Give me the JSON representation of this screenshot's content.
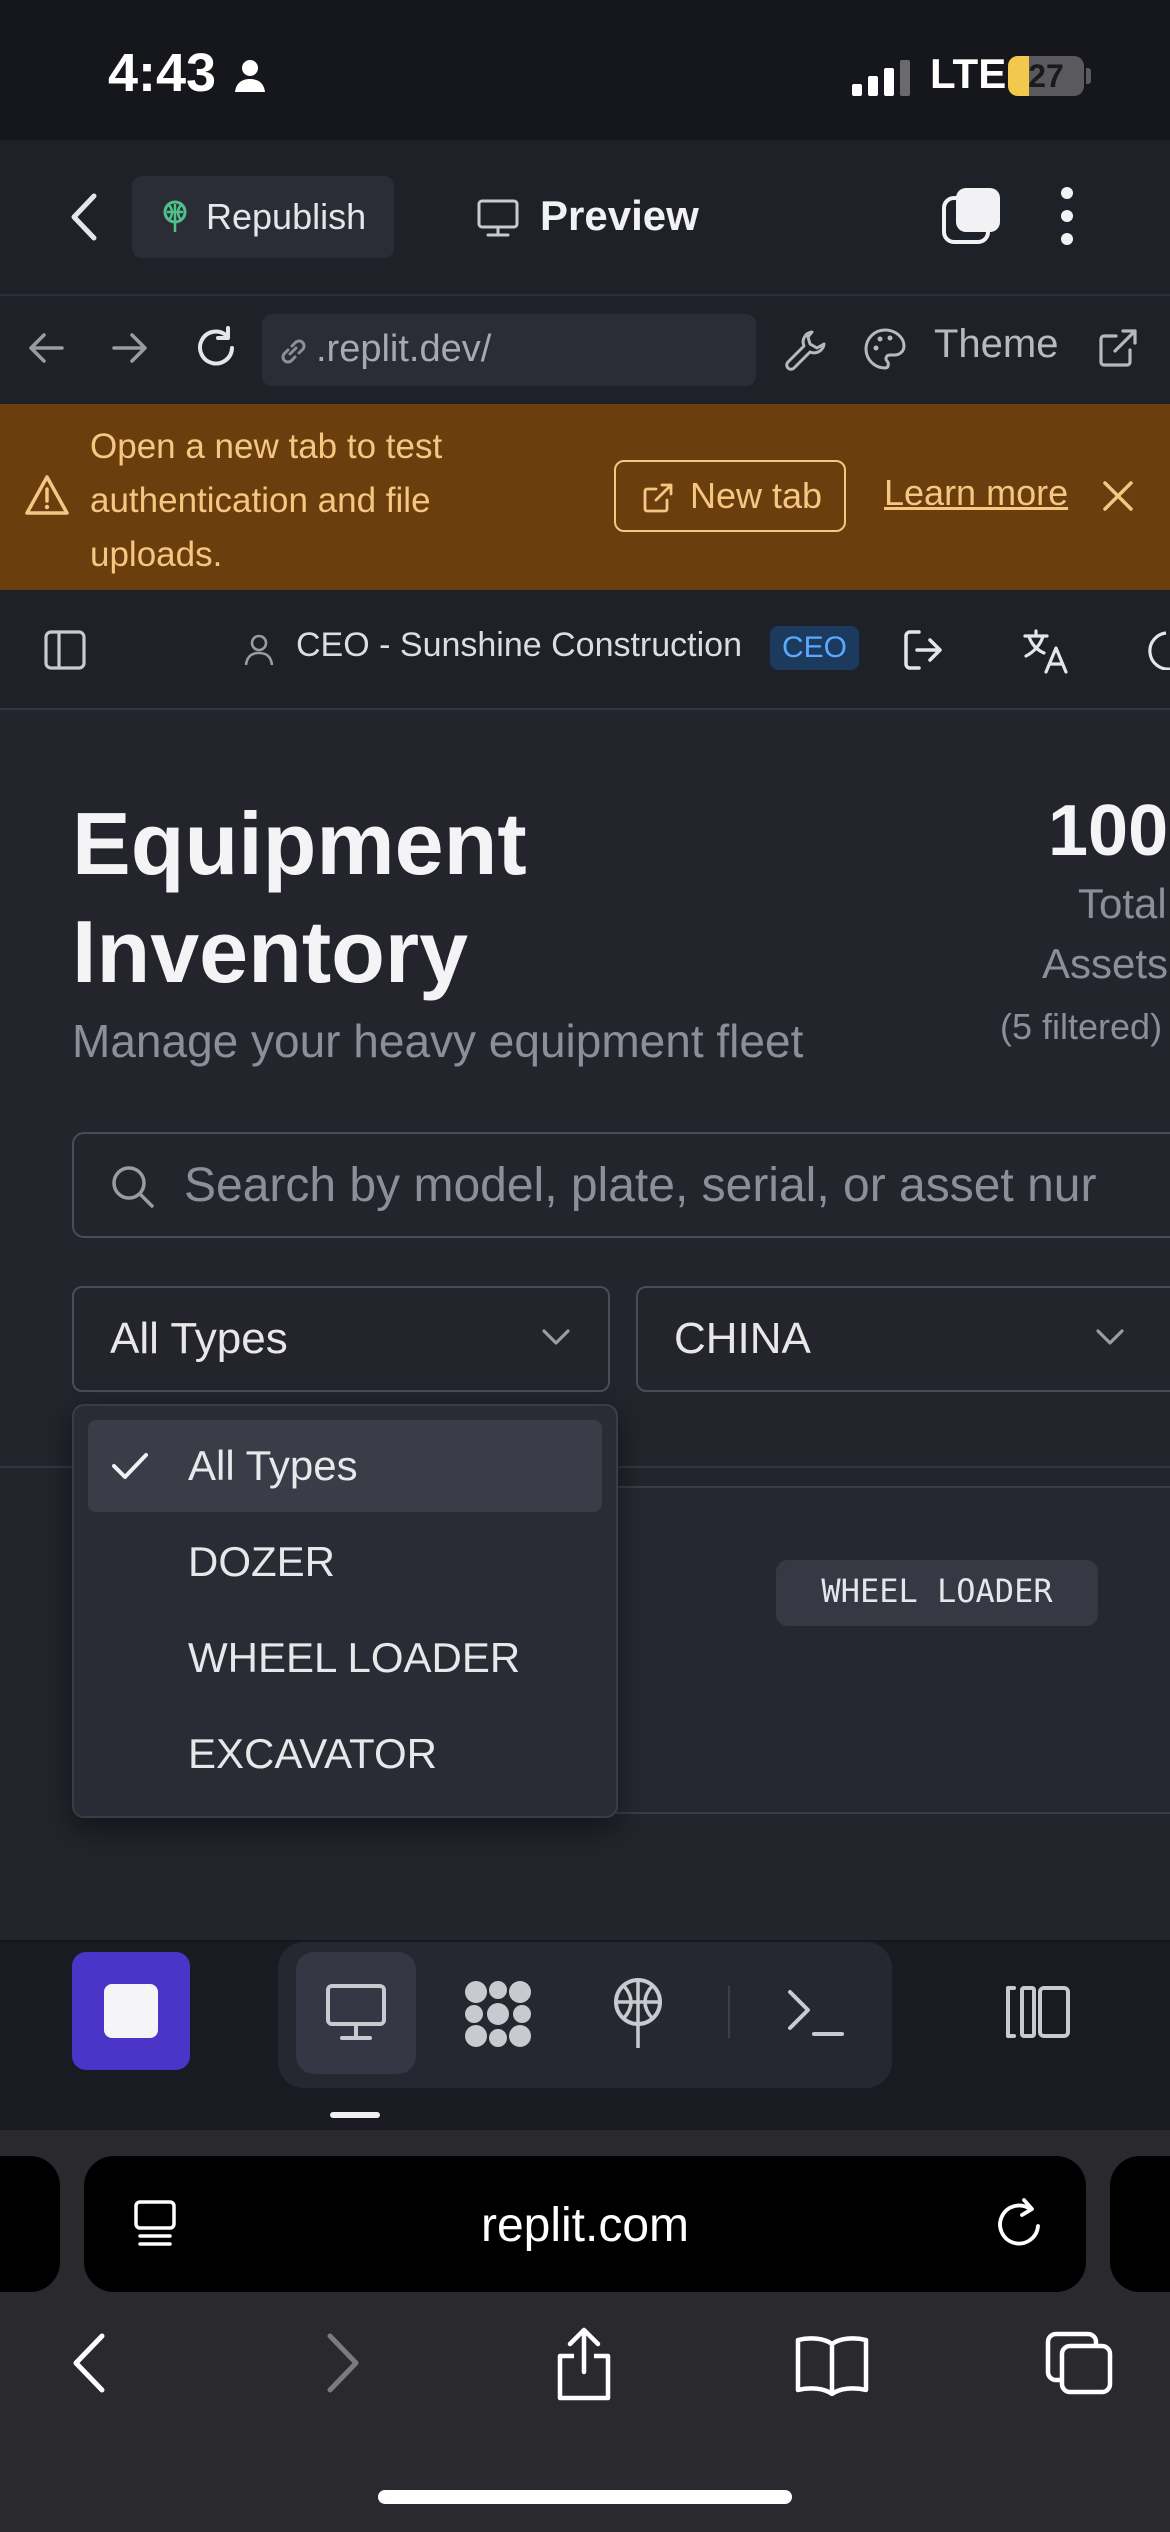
{
  "status_bar": {
    "time": "4:43",
    "network": "LTE",
    "battery": "27",
    "battery_level": 0.27
  },
  "toolbar": {
    "republish_label": "Republish",
    "preview_label": "Preview"
  },
  "address_bar": {
    "url": ".replit.dev/",
    "theme_label": "Theme"
  },
  "banner": {
    "message": "Open a new tab to test authentication and file uploads.",
    "new_tab_label": "New tab",
    "learn_more_label": "Learn more"
  },
  "app_header": {
    "user_label": "CEO - Sunshine Construction",
    "role_badge": "CEO"
  },
  "page": {
    "title_line1": "Equipment",
    "title_line2": "Inventory",
    "subtitle": "Manage your heavy equipment fleet",
    "stat_value": "100",
    "stat_label_line1": "Total",
    "stat_label_line2": "Assets",
    "stat_filtered": "(5 filtered)"
  },
  "search": {
    "placeholder": "Search by model, plate, serial, or asset nur"
  },
  "filters": {
    "type_selected": "All Types",
    "country_selected": "CHINA"
  },
  "type_options": [
    {
      "label": "All Types",
      "selected": true
    },
    {
      "label": "DOZER",
      "selected": false
    },
    {
      "label": "WHEEL LOADER",
      "selected": false
    },
    {
      "label": "EXCAVATOR",
      "selected": false
    }
  ],
  "card": {
    "badge": "WHEEL LOADER"
  },
  "safari": {
    "site": "replit.com"
  },
  "colors": {
    "accent_purple": "#4b34c8",
    "banner_bg": "#6b3f0d",
    "banner_text": "#f5c783",
    "role_badge": "#5aa9ff",
    "battery": "#f2c94c"
  },
  "icons": [
    "person-icon",
    "signal-icon",
    "chevron-left-icon",
    "deploy-icon",
    "monitor-icon",
    "tabs-icon",
    "more-icon",
    "arrow-left-icon",
    "arrow-right-icon",
    "reload-icon",
    "link-icon",
    "wrench-icon",
    "palette-icon",
    "external-link-icon",
    "warning-icon",
    "close-icon",
    "sidebar-icon",
    "user-icon",
    "logout-icon",
    "translate-icon",
    "moon-icon",
    "search-icon",
    "chevron-down-icon",
    "check-icon",
    "puzzle-icon",
    "console-icon",
    "layout-icon",
    "page-menu-icon",
    "share-icon",
    "bookmarks-icon"
  ]
}
